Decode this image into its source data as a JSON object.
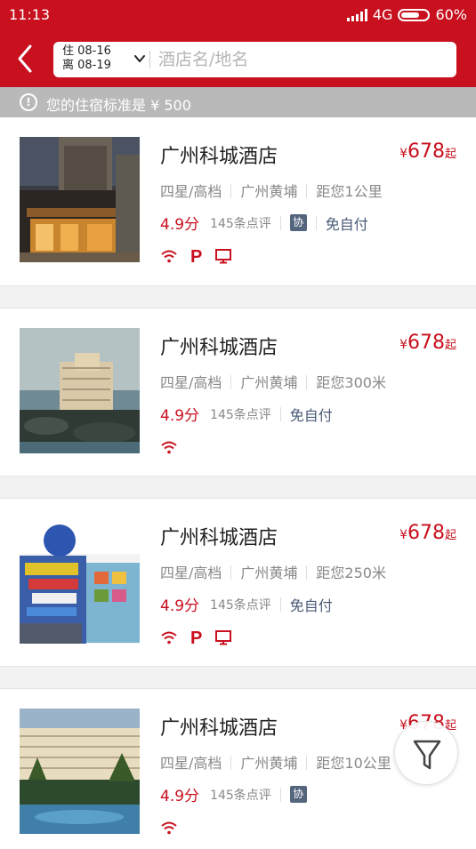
{
  "status_bar": {
    "time": "11:13",
    "network": "4G",
    "battery": "60%"
  },
  "search": {
    "checkin_label": "住 08-16",
    "checkout_label": "离 08-19",
    "placeholder": "酒店名/地名"
  },
  "notice": {
    "text": "您的住宿标准是 ¥ 500"
  },
  "colors": {
    "brand": "#c8101e",
    "tag": "#55657e",
    "notice_bg": "#b9b9b9"
  },
  "hotels": [
    {
      "name": "广州科城酒店",
      "price_symbol": "¥",
      "price": "678",
      "price_suffix": "起",
      "star": "四星/高档",
      "area": "广州黄埔",
      "distance": "距您1公里",
      "score": "4.9分",
      "reviews": "145条点评",
      "tag_xie": "协",
      "tag_free": "免自付",
      "amenities": [
        "wifi-icon",
        "parking-icon",
        "tv-icon"
      ]
    },
    {
      "name": "广州科城酒店",
      "price_symbol": "¥",
      "price": "678",
      "price_suffix": "起",
      "star": "四星/高档",
      "area": "广州黄埔",
      "distance": "距您300米",
      "score": "4.9分",
      "reviews": "145条点评",
      "tag_free": "免自付",
      "amenities": [
        "wifi-icon"
      ]
    },
    {
      "name": "广州科城酒店",
      "price_symbol": "¥",
      "price": "678",
      "price_suffix": "起",
      "star": "四星/高档",
      "area": "广州黄埔",
      "distance": "距您250米",
      "score": "4.9分",
      "reviews": "145条点评",
      "tag_free": "免自付",
      "amenities": [
        "wifi-icon",
        "parking-icon",
        "tv-icon"
      ]
    },
    {
      "name": "广州科城酒店",
      "price_symbol": "¥",
      "price": "678",
      "price_suffix": "起",
      "star": "四星/高档",
      "area": "广州黄埔",
      "distance": "距您10公里",
      "score": "4.9分",
      "reviews": "145条点评",
      "tag_xie": "协",
      "amenities": [
        "wifi-icon"
      ]
    }
  ],
  "parking_glyph": "P"
}
